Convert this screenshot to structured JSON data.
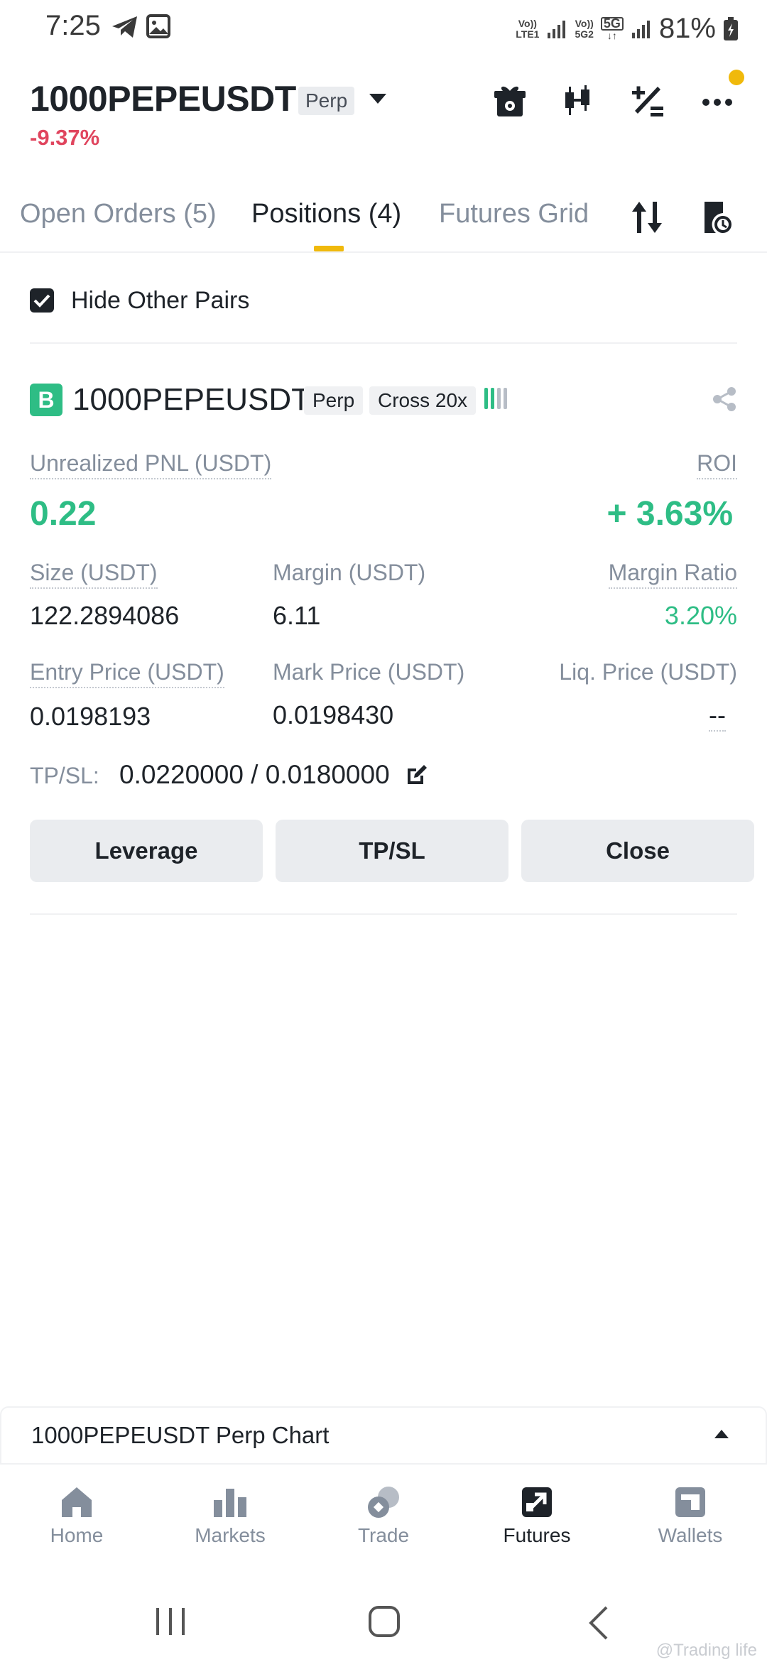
{
  "status_bar": {
    "time": "7:25",
    "net1_top": "Vo))",
    "net1_bottom": "LTE1",
    "net2_top": "Vo))",
    "net2_bottom": "5G2",
    "net3": "5G",
    "battery": "81%"
  },
  "header": {
    "symbol": "1000PEPEUSDT",
    "tag": "Perp",
    "change": "-9.37%"
  },
  "tabs": [
    {
      "label": "Open Orders (5)"
    },
    {
      "label": "Positions (4)"
    },
    {
      "label": "Futures Grid"
    }
  ],
  "filter": {
    "label": "Hide Other Pairs",
    "checked": true
  },
  "position": {
    "side": "B",
    "symbol": "1000PEPEUSDT",
    "tag1": "Perp",
    "tag2": "Cross 20x",
    "unrealized_pnl_label": "Unrealized PNL (USDT)",
    "unrealized_pnl": "0.22",
    "roi_label": "ROI",
    "roi": "+ 3.63%",
    "size_label": "Size (USDT)",
    "size": "122.2894086",
    "margin_label": "Margin (USDT)",
    "margin": "6.11",
    "margin_ratio_label": "Margin Ratio",
    "margin_ratio": "3.20%",
    "entry_label": "Entry Price (USDT)",
    "entry": "0.0198193",
    "mark_label": "Mark Price (USDT)",
    "mark": "0.0198430",
    "liq_label": "Liq. Price (USDT)",
    "liq": "--",
    "tpsl_label": "TP/SL:",
    "tpsl": "0.0220000 / 0.0180000"
  },
  "buttons": {
    "leverage": "Leverage",
    "tpsl": "TP/SL",
    "close": "Close"
  },
  "chart_bar": {
    "label": "1000PEPEUSDT Perp Chart"
  },
  "bottom_nav": [
    {
      "label": "Home",
      "icon": "home-icon"
    },
    {
      "label": "Markets",
      "icon": "markets-icon"
    },
    {
      "label": "Trade",
      "icon": "trade-icon"
    },
    {
      "label": "Futures",
      "icon": "futures-icon"
    },
    {
      "label": "Wallets",
      "icon": "wallets-icon"
    }
  ],
  "watermark": "@Trading life",
  "colors": {
    "green": "#2ebd85",
    "red": "#e0455e",
    "yellow": "#f0b90b",
    "grey_text": "#848e9c",
    "dark_text": "#1e2329"
  }
}
